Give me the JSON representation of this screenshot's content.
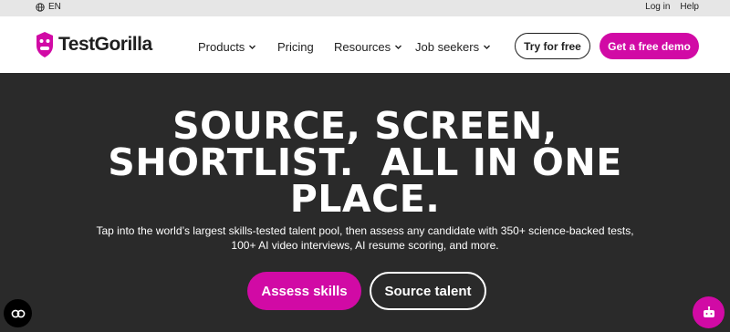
{
  "utility": {
    "language": "EN",
    "login": "Log in",
    "help": "Help"
  },
  "header": {
    "logo_text": "TestGorilla",
    "nav": [
      {
        "label": "Products",
        "has_dropdown": true
      },
      {
        "label": "Pricing",
        "has_dropdown": false
      },
      {
        "label": "Resources",
        "has_dropdown": true
      },
      {
        "label": "Job seekers",
        "has_dropdown": true
      }
    ],
    "try_free": "Try for free",
    "demo": "Get a free demo"
  },
  "hero": {
    "title_line1": "SOURCE, SCREEN,",
    "title_line2": "SHORTLIST.  ALL IN ONE",
    "title_line3": "PLACE.",
    "subtitle_line1": "Tap into the world’s largest skills-tested talent pool, then assess any candidate with 350+ science-backed tests,",
    "subtitle_line2": "100+ AI video interviews, AI resume scoring, and more.",
    "primary_cta": "Assess skills",
    "secondary_cta": "Source talent"
  },
  "colors": {
    "brand": "#d10aa5",
    "hero_bg": "#2a2a2a",
    "utility_bg": "#e6e6e6"
  },
  "icons": {
    "language": "globe-icon",
    "logo": "gorilla-logo-icon",
    "dropdown": "chevron-down-icon",
    "accessibility": "accessibility-icon",
    "chat": "chat-bot-icon"
  }
}
